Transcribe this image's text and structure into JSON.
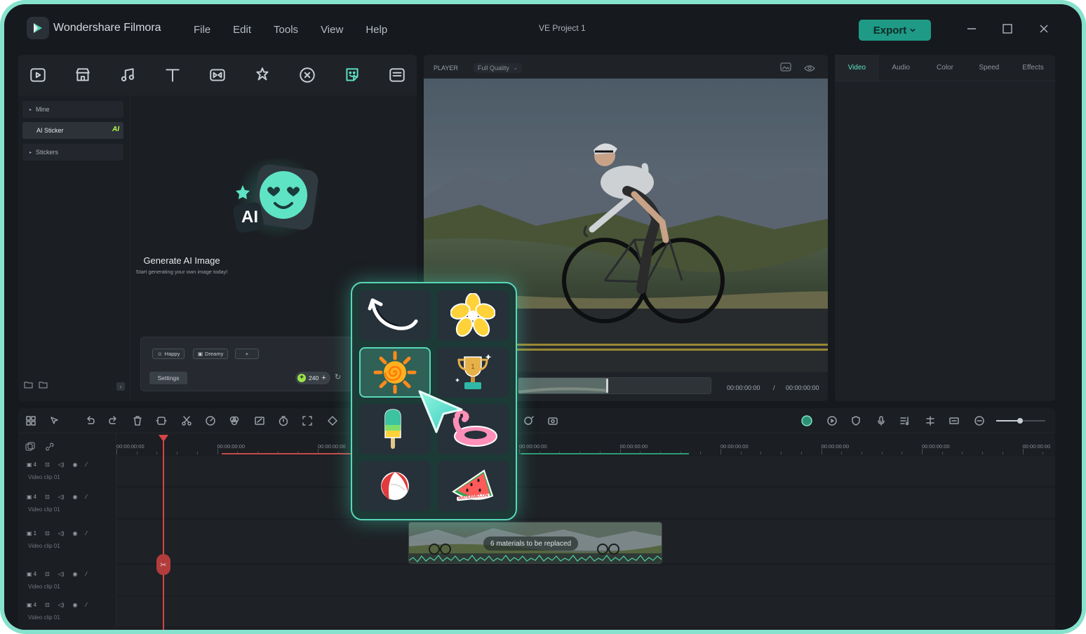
{
  "titlebar": {
    "app_name": "Wondershare Filmora",
    "menu": [
      "File",
      "Edit",
      "Tools",
      "View",
      "Help"
    ],
    "project_name": "VE Project 1",
    "export_label": "Export"
  },
  "toolbar": {
    "icons": [
      "media-icon",
      "stock-media-icon",
      "audio-icon",
      "text-icon",
      "transition-icon",
      "effects-icon",
      "filters-icon",
      "stickers-icon",
      "templates-icon"
    ],
    "active": "stickers-icon"
  },
  "sidebar": {
    "items": [
      {
        "label": "Mine"
      },
      {
        "label": "AI Sticker",
        "badge": "AI"
      },
      {
        "label": "Stickers"
      }
    ]
  },
  "generator": {
    "badge": "AI",
    "title": "Generate AI Image",
    "subtitle": "Start generating your own image today!"
  },
  "prompt": {
    "chips": [
      "Happy",
      "Dreamy",
      "+"
    ],
    "settings_label": "Settings",
    "credits": "240"
  },
  "player": {
    "label": "PLAYER",
    "quality": "Full Quality",
    "current_time": "00:00:00:00",
    "separator": "/",
    "total_time": "00:00:00:00"
  },
  "properties": {
    "tabs": [
      "Video",
      "Audio",
      "Color",
      "Speed",
      "Effects"
    ],
    "active_tab": "Video"
  },
  "timeline": {
    "ruler": [
      "00:00:00:00",
      "00:00:00:00",
      "00:00:00:00",
      "00:00:00:00",
      "00:00:00:00",
      "00:00:00:00",
      "00:00:00:00",
      "00:00:00:00",
      "00:00:00:00",
      "00:00:00:00"
    ],
    "tracks": [
      {
        "num": "4",
        "label": "Video clip 01"
      },
      {
        "num": "4",
        "label": "Video clip 01"
      },
      {
        "num": "1",
        "label": "Video clip 01"
      },
      {
        "num": "4",
        "label": "Video clip 01"
      },
      {
        "num": "4",
        "label": "Video clip 01"
      }
    ],
    "clip_label": "6 materials to be replaced"
  },
  "sticker_popup": {
    "items": [
      "swoosh-arrow-sticker",
      "yellow-flower-sticker",
      "sun-sticker",
      "trophy-sticker",
      "popsicle-sticker",
      "flamingo-float-sticker",
      "beach-ball-sticker",
      "watermelon-sticker"
    ],
    "selected": "sun-sticker",
    "watermelon_text": "WATERMELON"
  },
  "colors": {
    "accent": "#5ee3c5",
    "export_bg": "#1e9a86",
    "frame": "#86e2cc",
    "playhead": "#d64545",
    "ai_badge": "#b4ff4c"
  }
}
